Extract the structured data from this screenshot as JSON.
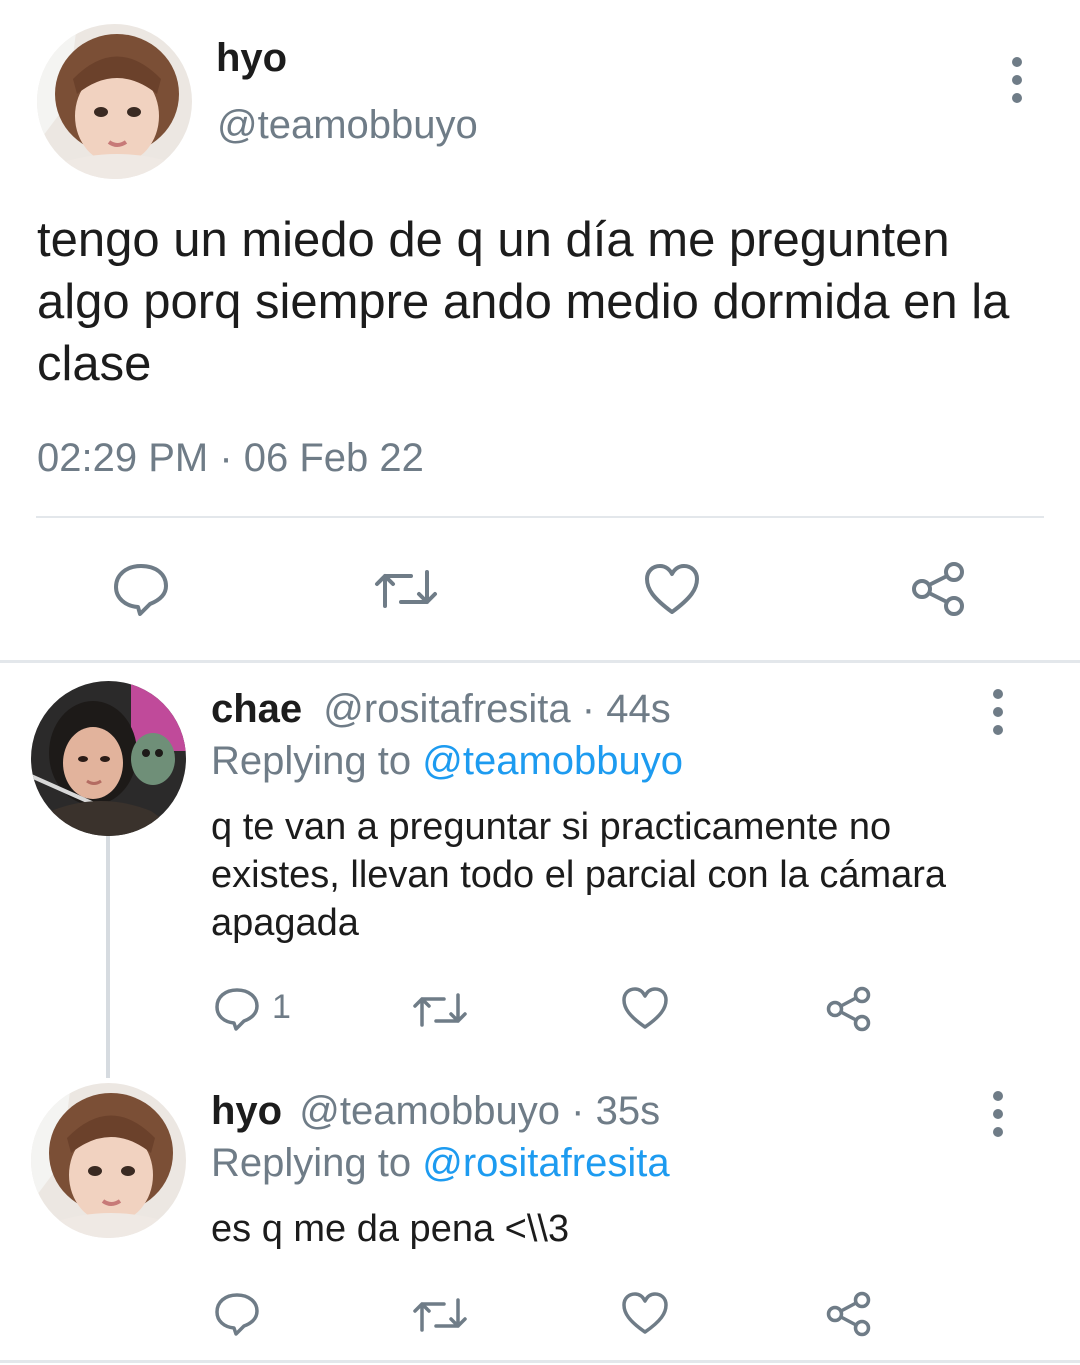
{
  "main_tweet": {
    "name": "hyo",
    "handle": "@teamobbuyo",
    "text": "tengo un miedo de q un día me pregunten algo porq siempre ando medio dormida en la clase",
    "timestamp": "02:29 PM · 06 Feb 22"
  },
  "replies": [
    {
      "name": "chae",
      "handle": "@rositafresita",
      "time": "· 44s",
      "replying_prefix": "Replying to",
      "replying_to": "@teamobbuyo",
      "text": "q te van a preguntar si practicamente no existes, llevan todo el parcial con la cámara apagada",
      "reply_count": "1"
    },
    {
      "name": "hyo",
      "handle": "@teamobbuyo",
      "time": "· 35s",
      "replying_prefix": "Replying to",
      "replying_to": "@rositafresita",
      "text": "es q me da pena <\\\\3",
      "reply_count": ""
    }
  ],
  "icons": {
    "reply": "reply-icon",
    "retweet": "retweet-icon",
    "like": "heart-icon",
    "share": "share-icon",
    "more": "more-vertical-icon"
  },
  "colors": {
    "text": "#1c1c1c",
    "muted": "#6f7c87",
    "link": "#1d9bf0",
    "divider": "#e3e7eb"
  }
}
